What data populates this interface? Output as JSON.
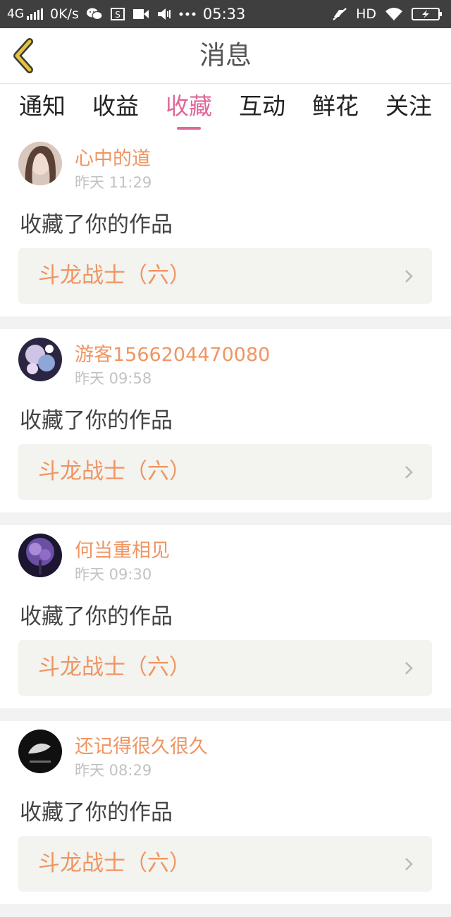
{
  "status_bar": {
    "network": "4G",
    "speed": "0K/s",
    "time": "05:33",
    "hd": "HD",
    "icons": [
      "signal-bars-icon",
      "wechat-icon",
      "screenshot-icon",
      "video-icon",
      "vibrate-icon",
      "more-dots-icon",
      "mute-icon",
      "wifi-icon",
      "battery-charging-icon"
    ]
  },
  "header": {
    "title": "消息",
    "back_icon": "chevron-left-icon"
  },
  "tabs": [
    {
      "label": "通知",
      "active": false
    },
    {
      "label": "收益",
      "active": false
    },
    {
      "label": "收藏",
      "active": true
    },
    {
      "label": "互动",
      "active": false
    },
    {
      "label": "鲜花",
      "active": false
    },
    {
      "label": "关注",
      "active": false
    }
  ],
  "messages": [
    {
      "user": "心中的道",
      "time": "昨天 11:29",
      "action": "收藏了你的作品",
      "work": "斗龙战士（六）",
      "avatar": "avatar-girl-photo"
    },
    {
      "user": "游客1566204470080",
      "time": "昨天 09:58",
      "action": "收藏了你的作品",
      "work": "斗龙战士（六）",
      "avatar": "avatar-anime-art"
    },
    {
      "user": "何当重相见",
      "time": "昨天 09:30",
      "action": "收藏了你的作品",
      "work": "斗龙战士（六）",
      "avatar": "avatar-purple-tree"
    },
    {
      "user": "还记得很久很久",
      "time": "昨天 08:29",
      "action": "收藏了你的作品",
      "work": "斗龙战士（六）",
      "avatar": "avatar-dark-photo"
    }
  ],
  "colors": {
    "accent": "#e0679a",
    "orange": "#ef9562",
    "back_icon": "#e5c33a",
    "status_bar": "#3f3f3f"
  }
}
